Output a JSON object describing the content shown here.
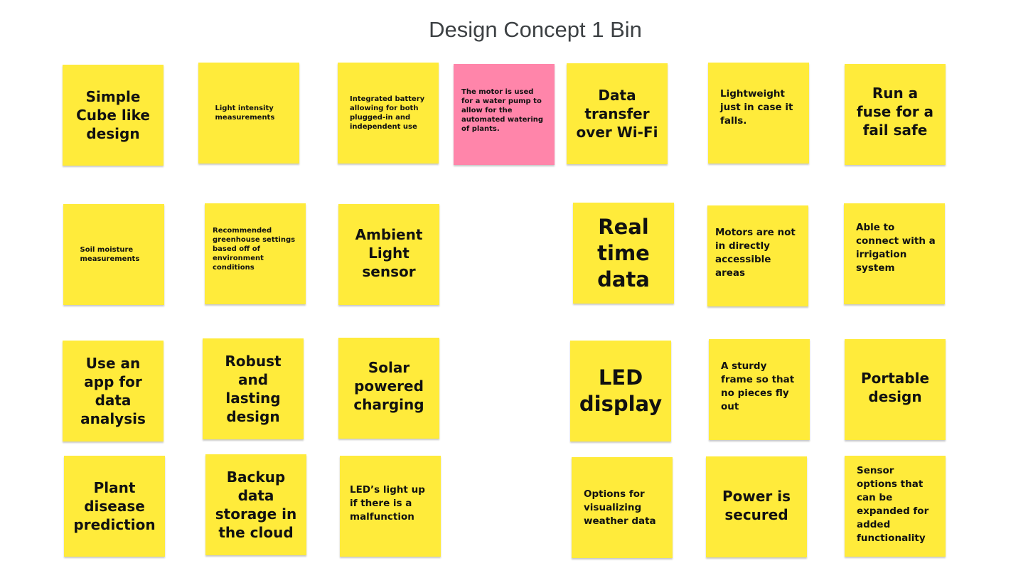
{
  "board": {
    "title": "Design Concept 1 Bin",
    "colors": {
      "yellow": "#ffeb3b",
      "pink": "#ff85aa",
      "title": "#3c4043"
    }
  },
  "notes": [
    {
      "text": "Simple Cube like design",
      "color": "yellow"
    },
    {
      "text": "Light intensity measurements",
      "color": "yellow"
    },
    {
      "text": "Integrated battery allowing for both plugged-in and independent use",
      "color": "yellow"
    },
    {
      "text": "The motor is used for a water pump to allow for the automated watering of plants.",
      "color": "pink"
    },
    {
      "text": "Data transfer over Wi-Fi",
      "color": "yellow"
    },
    {
      "text": "Lightweight just in case it falls.",
      "color": "yellow"
    },
    {
      "text": "Run a fuse for a fail safe",
      "color": "yellow"
    },
    {
      "text": "Soil moisture measurements",
      "color": "yellow"
    },
    {
      "text": "Recommended greenhouse settings based off of environment conditions",
      "color": "yellow"
    },
    {
      "text": "Ambient Light sensor",
      "color": "yellow"
    },
    {
      "text": "Real time data",
      "color": "yellow"
    },
    {
      "text": "Motors are not in directly accessible areas",
      "color": "yellow"
    },
    {
      "text": "Able to connect with a irrigation system",
      "color": "yellow"
    },
    {
      "text": "Use an app for data analysis",
      "color": "yellow"
    },
    {
      "text": "Robust and lasting design",
      "color": "yellow"
    },
    {
      "text": "Solar powered charging",
      "color": "yellow"
    },
    {
      "text": "LED display",
      "color": "yellow"
    },
    {
      "text": "A sturdy frame so that no pieces fly out",
      "color": "yellow"
    },
    {
      "text": "Portable design",
      "color": "yellow"
    },
    {
      "text": "Plant disease prediction",
      "color": "yellow"
    },
    {
      "text": "Backup data storage in the cloud",
      "color": "yellow"
    },
    {
      "text": "LED’s light up if there is a malfunction",
      "color": "yellow"
    },
    {
      "text": "Options for visualizing weather data",
      "color": "yellow"
    },
    {
      "text": "Power is secured",
      "color": "yellow"
    },
    {
      "text": "Sensor options that can be expanded for added functionality",
      "color": "yellow"
    }
  ]
}
